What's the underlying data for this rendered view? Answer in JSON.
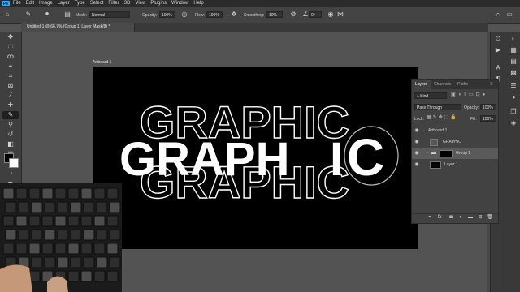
{
  "menu": {
    "app_icon": "Ps",
    "items": [
      "File",
      "Edit",
      "Image",
      "Layer",
      "Type",
      "Select",
      "Filter",
      "3D",
      "View",
      "Plugins",
      "Window",
      "Help"
    ]
  },
  "options": {
    "mode_label": "Mode:",
    "mode_value": "Normal",
    "opacity_label": "Opacity:",
    "opacity_value": "100%",
    "flow_label": "Flow:",
    "flow_value": "100%",
    "smoothing_label": "Smoothing:",
    "smoothing_value": "10%",
    "angle_value": "0°"
  },
  "document": {
    "tab_title": "Untitled-1 @ 66.7% (Group 1, Layer Mask/8) *",
    "artboard_label": "Artboard 1",
    "graphic_text": "GRAPHIC",
    "graphic_split_main": "GRAPH",
    "graphic_split_i": "I",
    "graphic_split_c": "C"
  },
  "layers_panel": {
    "tabs": [
      "Layers",
      "Channels",
      "Paths"
    ],
    "active_tab": "Layers",
    "kind_label": "Kind",
    "blend_mode": "Pass Through",
    "opacity_label": "Opacity:",
    "opacity_value": "100%",
    "lock_label": "Lock:",
    "fill_label": "Fill:",
    "fill_value": "100%",
    "layers": [
      {
        "name": "Artboard 1",
        "selected": false
      },
      {
        "name": "GRAPHIC",
        "selected": false
      },
      {
        "name": "Group 1",
        "selected": true
      },
      {
        "name": "Layer 1",
        "selected": false
      }
    ],
    "footer_icons": [
      "link-icon",
      "fx-icon",
      "mask-icon",
      "adjustment-icon",
      "folder-icon",
      "new-layer-icon",
      "trash-icon"
    ]
  },
  "colors": {
    "brand": "#31a8ff",
    "artboard_bg": "#000000",
    "panel_bg": "#424242",
    "selected_row": "#5a5a5a"
  }
}
